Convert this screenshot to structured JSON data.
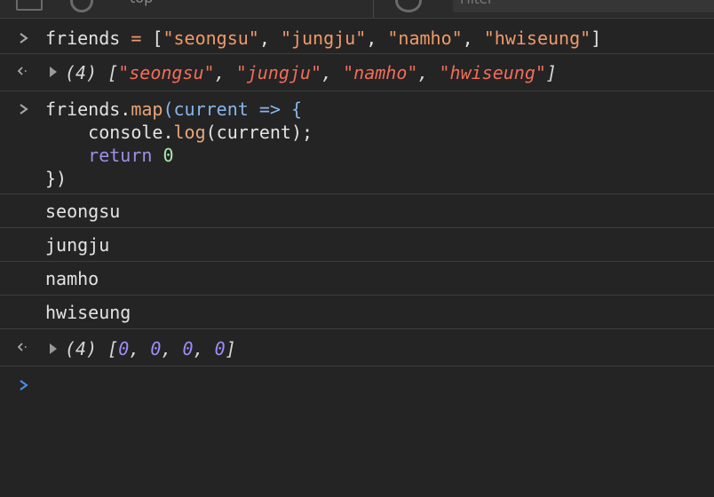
{
  "toolbar": {
    "context_label": "top",
    "filter_placeholder": "Filter"
  },
  "entries": {
    "input1": {
      "code": {
        "var": "friends",
        "op": " = ",
        "open": "[",
        "s1": "\"seongsu\"",
        "s2": "\"jungju\"",
        "s3": "\"namho\"",
        "s4": "\"hwiseung\"",
        "sep": ", ",
        "close": "]"
      }
    },
    "output1": {
      "count": "(4)",
      "open": "[",
      "s1": "\"seongsu\"",
      "s2": "\"jungju\"",
      "s3": "\"namho\"",
      "s4": "\"hwiseung\"",
      "sep": ", ",
      "close": "]"
    },
    "input2": {
      "l1_obj": "friends",
      "l1_dot": ".",
      "l1_fn": "map",
      "l1_paren": "(",
      "l1_param": "current",
      "l1_arrow": " => {",
      "l2_indent": "    ",
      "l2_obj": "console",
      "l2_dot": ".",
      "l2_fn": "log",
      "l2_args": "(current);",
      "l3_indent": "    ",
      "l3_kw": "return",
      "l3_space": " ",
      "l3_num": "0",
      "l4": "})"
    },
    "logs": [
      "seongsu",
      "jungju",
      "namho",
      "hwiseung"
    ],
    "output2": {
      "count": "(4)",
      "open": "[",
      "v1": "0",
      "v2": "0",
      "v3": "0",
      "v4": "0",
      "sep": ", ",
      "close": "]"
    }
  },
  "colors": {
    "background": "#242424",
    "string": "#ef9a6a",
    "keyword": "#a08fe6",
    "number": "#a8e8a8",
    "prompt_active": "#4a8ff0"
  },
  "icons": {
    "input_prompt": "chevron-right-icon",
    "result_marker": "result-arrow-icon",
    "expand": "expand-triangle-icon"
  }
}
